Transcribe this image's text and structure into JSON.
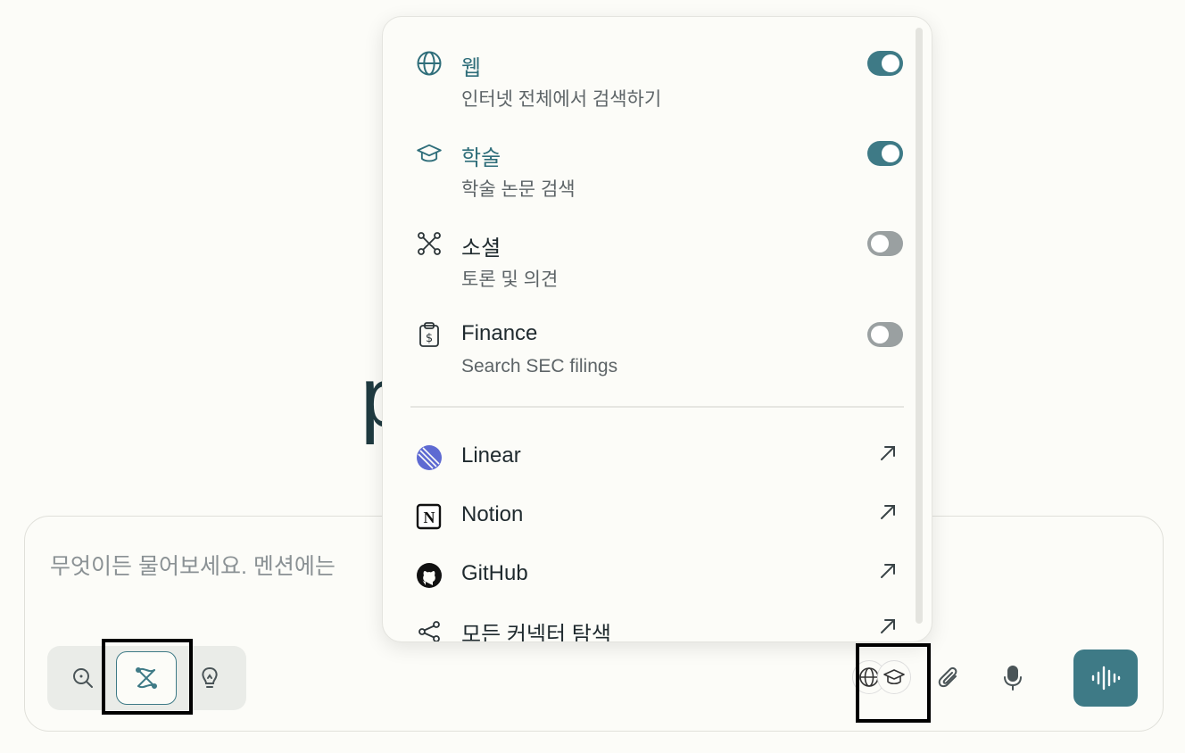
{
  "background": {
    "logo_partial": "p"
  },
  "composer": {
    "placeholder": "무엇이든 물어보세요. 멘션에는"
  },
  "modes": [
    {
      "name": "search",
      "icon": "magnifier-icon",
      "selected": false
    },
    {
      "name": "research",
      "icon": "research-icon",
      "selected": true
    },
    {
      "name": "labs",
      "icon": "lightbulb-icon",
      "selected": false
    }
  ],
  "tools": {
    "sources_icons": [
      "globe-icon",
      "graduation-cap-icon"
    ],
    "attach_icon": "paperclip-icon",
    "mic_icon": "microphone-icon",
    "voice_icon": "voice-waveform-icon"
  },
  "sources": [
    {
      "title": "웹",
      "desc": "인터넷 전체에서 검색하기",
      "icon": "globe-icon",
      "enabled": true
    },
    {
      "title": "학술",
      "desc": "학술 논문 검색",
      "icon": "graduation-cap-icon",
      "enabled": true
    },
    {
      "title": "소셜",
      "desc": "토론 및 의견",
      "icon": "social-network-icon",
      "enabled": false
    },
    {
      "title": "Finance",
      "desc": "Search SEC filings",
      "icon": "finance-clipboard-icon",
      "enabled": false
    }
  ],
  "connectors": [
    {
      "label": "Linear",
      "icon": "linear-logo-icon"
    },
    {
      "label": "Notion",
      "icon": "notion-logo-icon"
    },
    {
      "label": "GitHub",
      "icon": "github-logo-icon"
    },
    {
      "label": "모든 커넥터 탐색",
      "icon": "share-nodes-icon"
    }
  ],
  "colors": {
    "accent": "#3e7a86",
    "accent_text": "#2f6e7a",
    "toggle_off": "#9aa0a1",
    "background": "#fcfcf8"
  }
}
